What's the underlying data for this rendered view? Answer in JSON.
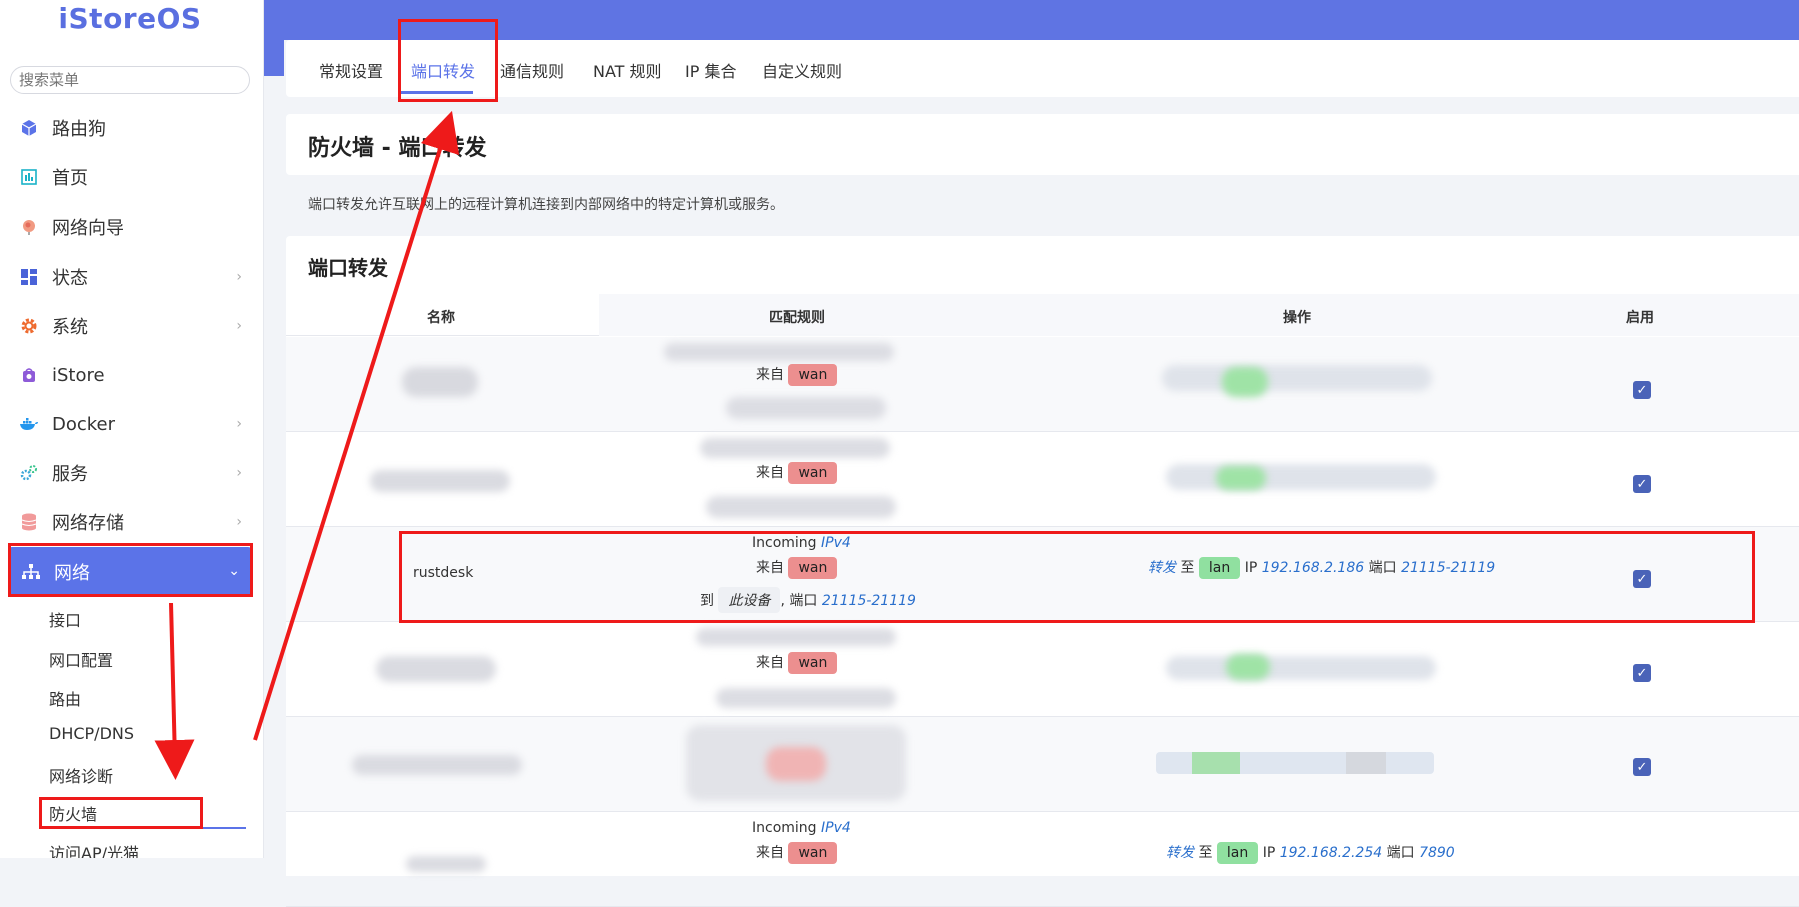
{
  "app": {
    "logo": "iStoreOS"
  },
  "sidebar": {
    "search_placeholder": "搜索菜单",
    "items": [
      {
        "label": "路由狗",
        "icon": "cube-icon"
      },
      {
        "label": "首页",
        "icon": "chart-icon"
      },
      {
        "label": "网络向导",
        "icon": "globe-icon"
      },
      {
        "label": "状态",
        "icon": "dashboard-icon"
      },
      {
        "label": "系统",
        "icon": "gear-icon"
      },
      {
        "label": "iStore",
        "icon": "store-icon"
      },
      {
        "label": "Docker",
        "icon": "docker-icon"
      },
      {
        "label": "服务",
        "icon": "cogs-icon"
      },
      {
        "label": "网络存储",
        "icon": "database-icon"
      },
      {
        "label": "网络",
        "icon": "network-icon"
      }
    ],
    "sub_items": [
      "接口",
      "网口配置",
      "路由",
      "DHCP/DNS",
      "网络诊断",
      "防火墙",
      "访问AP/光猫"
    ]
  },
  "tabs": [
    "常规设置",
    "端口转发",
    "通信规则",
    "NAT 规则",
    "IP 集合",
    "自定义规则"
  ],
  "page": {
    "title": "防火墙 - 端口转发",
    "description": "端口转发允许互联网上的远程计算机连接到内部网络中的特定计算机或服务。",
    "section_title": "端口转发"
  },
  "table": {
    "headers": {
      "name": "名称",
      "match": "匹配规则",
      "action": "操作",
      "enable": "启用"
    },
    "from_label": "来自",
    "zone_wan": "wan",
    "row_rustdesk": {
      "name": "rustdesk",
      "incoming": "Incoming",
      "ipv4": "IPv4",
      "from": "来自",
      "zone": "wan",
      "to": "到",
      "device": "此设备",
      "port_sep": ", 端口",
      "ports": "21115-21119",
      "forward": "转发",
      "to2": "至",
      "lan": "lan",
      "ip_label": "IP",
      "ip": "192.168.2.186",
      "port_label": "端口",
      "dest_ports": "21115-21119"
    },
    "row_last": {
      "incoming": "Incoming",
      "ipv4": "IPv4",
      "from": "来自",
      "zone": "wan",
      "forward": "转发",
      "to2": "至",
      "lan": "lan",
      "ip_label": "IP",
      "ip": "192.168.2.254",
      "port_label": "端口",
      "dest_ports": "7890"
    },
    "checkmark": "✓"
  }
}
